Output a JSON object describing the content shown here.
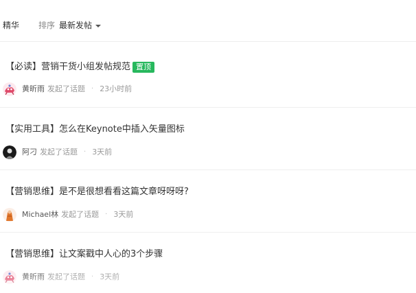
{
  "filter_bar": {
    "tab_featured": "精华",
    "sort_label": "排序",
    "sort_value": "最新发帖"
  },
  "posts": [
    {
      "title": "【必读】营销干货小组发帖规范",
      "badge": "置顶",
      "author": "黄昕雨",
      "action": "发起了话题",
      "separator": "·",
      "time": "23小时前",
      "avatar_icon": "cartoon-avatar-icon"
    },
    {
      "title": "【实用工具】怎么在Keynote中插入矢量图标",
      "author": "阿刁",
      "action": "发起了话题",
      "separator": "·",
      "time": "3天前",
      "avatar_icon": "photo-avatar-icon"
    },
    {
      "title": "【营销思维】是不是很想看看这篇文章呀呀呀?",
      "author": "Michael林",
      "action": "发起了话题",
      "separator": "·",
      "time": "3天前",
      "avatar_icon": "figure-avatar-icon"
    },
    {
      "title": "【营销思维】让文案戳中人心的3个步骤",
      "author": "黄昕雨",
      "action": "发起了话题",
      "separator": "·",
      "time": "3天前",
      "avatar_icon": "cartoon-avatar-icon"
    }
  ],
  "colors": {
    "pin_badge": "#27b85d",
    "divider": "#eeeeee",
    "muted_text": "#999999"
  }
}
